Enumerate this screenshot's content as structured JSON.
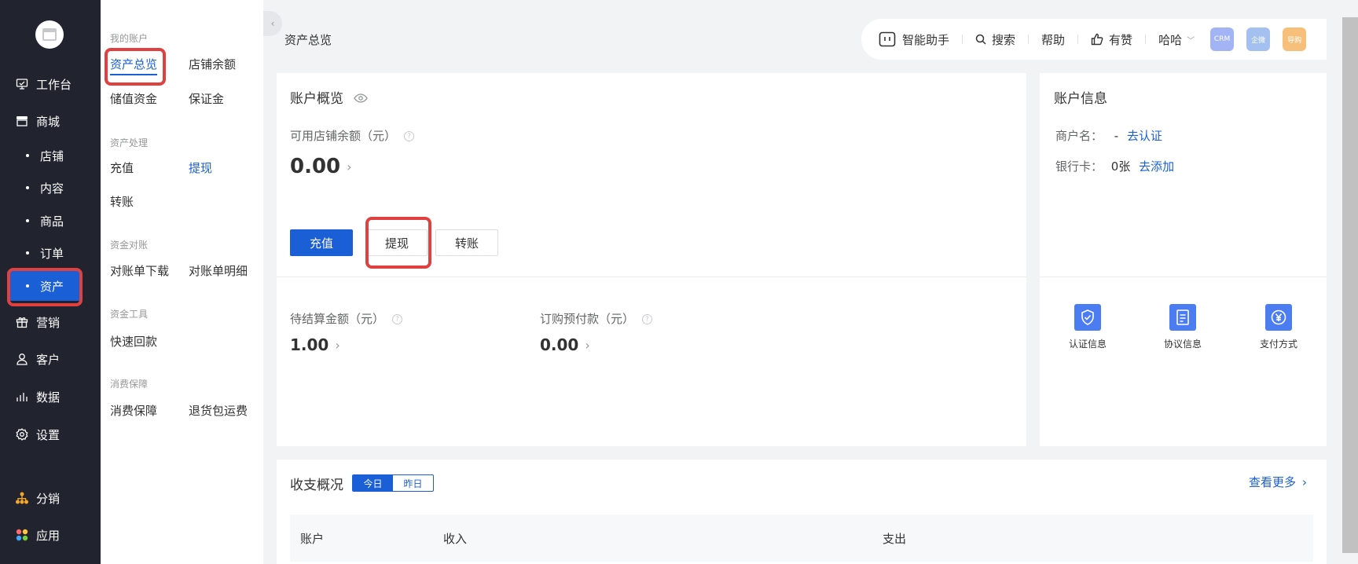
{
  "sidebar": {
    "items": [
      {
        "label": "工作台",
        "icon": "workbench-icon"
      },
      {
        "label": "商城",
        "icon": "store-icon"
      },
      {
        "label": "店铺"
      },
      {
        "label": "内容"
      },
      {
        "label": "商品"
      },
      {
        "label": "订单"
      },
      {
        "label": "资产",
        "active": true
      },
      {
        "label": "营销",
        "icon": "gift-icon"
      },
      {
        "label": "客户",
        "icon": "user-icon"
      },
      {
        "label": "数据",
        "icon": "chart-icon"
      },
      {
        "label": "设置",
        "icon": "gear-icon"
      },
      {
        "label": "分销",
        "icon": "distribution-icon"
      },
      {
        "label": "应用",
        "icon": "apps-icon"
      }
    ]
  },
  "submenu": {
    "groups": [
      {
        "title": "我的账户",
        "links": [
          "资产总览",
          "店铺余额",
          "储值资金",
          "保证金"
        ]
      },
      {
        "title": "资产处理",
        "links": [
          "充值",
          "提现",
          "转账"
        ]
      },
      {
        "title": "资金对账",
        "links": [
          "对账单下载",
          "对账单明细"
        ]
      },
      {
        "title": "资金工具",
        "links": [
          "快速回款"
        ]
      },
      {
        "title": "消费保障",
        "links": [
          "消费保障",
          "退货包运费"
        ]
      }
    ]
  },
  "header": {
    "page_title": "资产总览",
    "assistant": "智能助手",
    "search": "搜索",
    "help": "帮助",
    "like": "有赞",
    "user": "哈哈",
    "avatars": [
      "CRM",
      "企微",
      "导购"
    ]
  },
  "overview": {
    "title": "账户概览",
    "balance_label": "可用店铺余额（元）",
    "balance": "0.00",
    "buttons": {
      "recharge": "充值",
      "withdraw": "提现",
      "transfer": "转账"
    },
    "pending_label": "待结算金额（元）",
    "pending": "1.00",
    "prepay_label": "订购预付款（元）",
    "prepay": "0.00"
  },
  "account_info": {
    "title": "账户信息",
    "merchant_label": "商户名：",
    "merchant_value": "-",
    "merchant_link": "去认证",
    "bank_label": "银行卡：",
    "bank_value": "0张",
    "bank_link": "去添加",
    "features": [
      "认证信息",
      "协议信息",
      "支付方式"
    ]
  },
  "income": {
    "title": "收支概况",
    "tabs": [
      "今日",
      "昨日"
    ],
    "more": "查看更多",
    "columns": [
      "账户",
      "收入",
      "支出"
    ]
  },
  "colors": {
    "accent": "#1a5fd6",
    "sidebar": "#21232f",
    "highlight": "#e04040"
  }
}
